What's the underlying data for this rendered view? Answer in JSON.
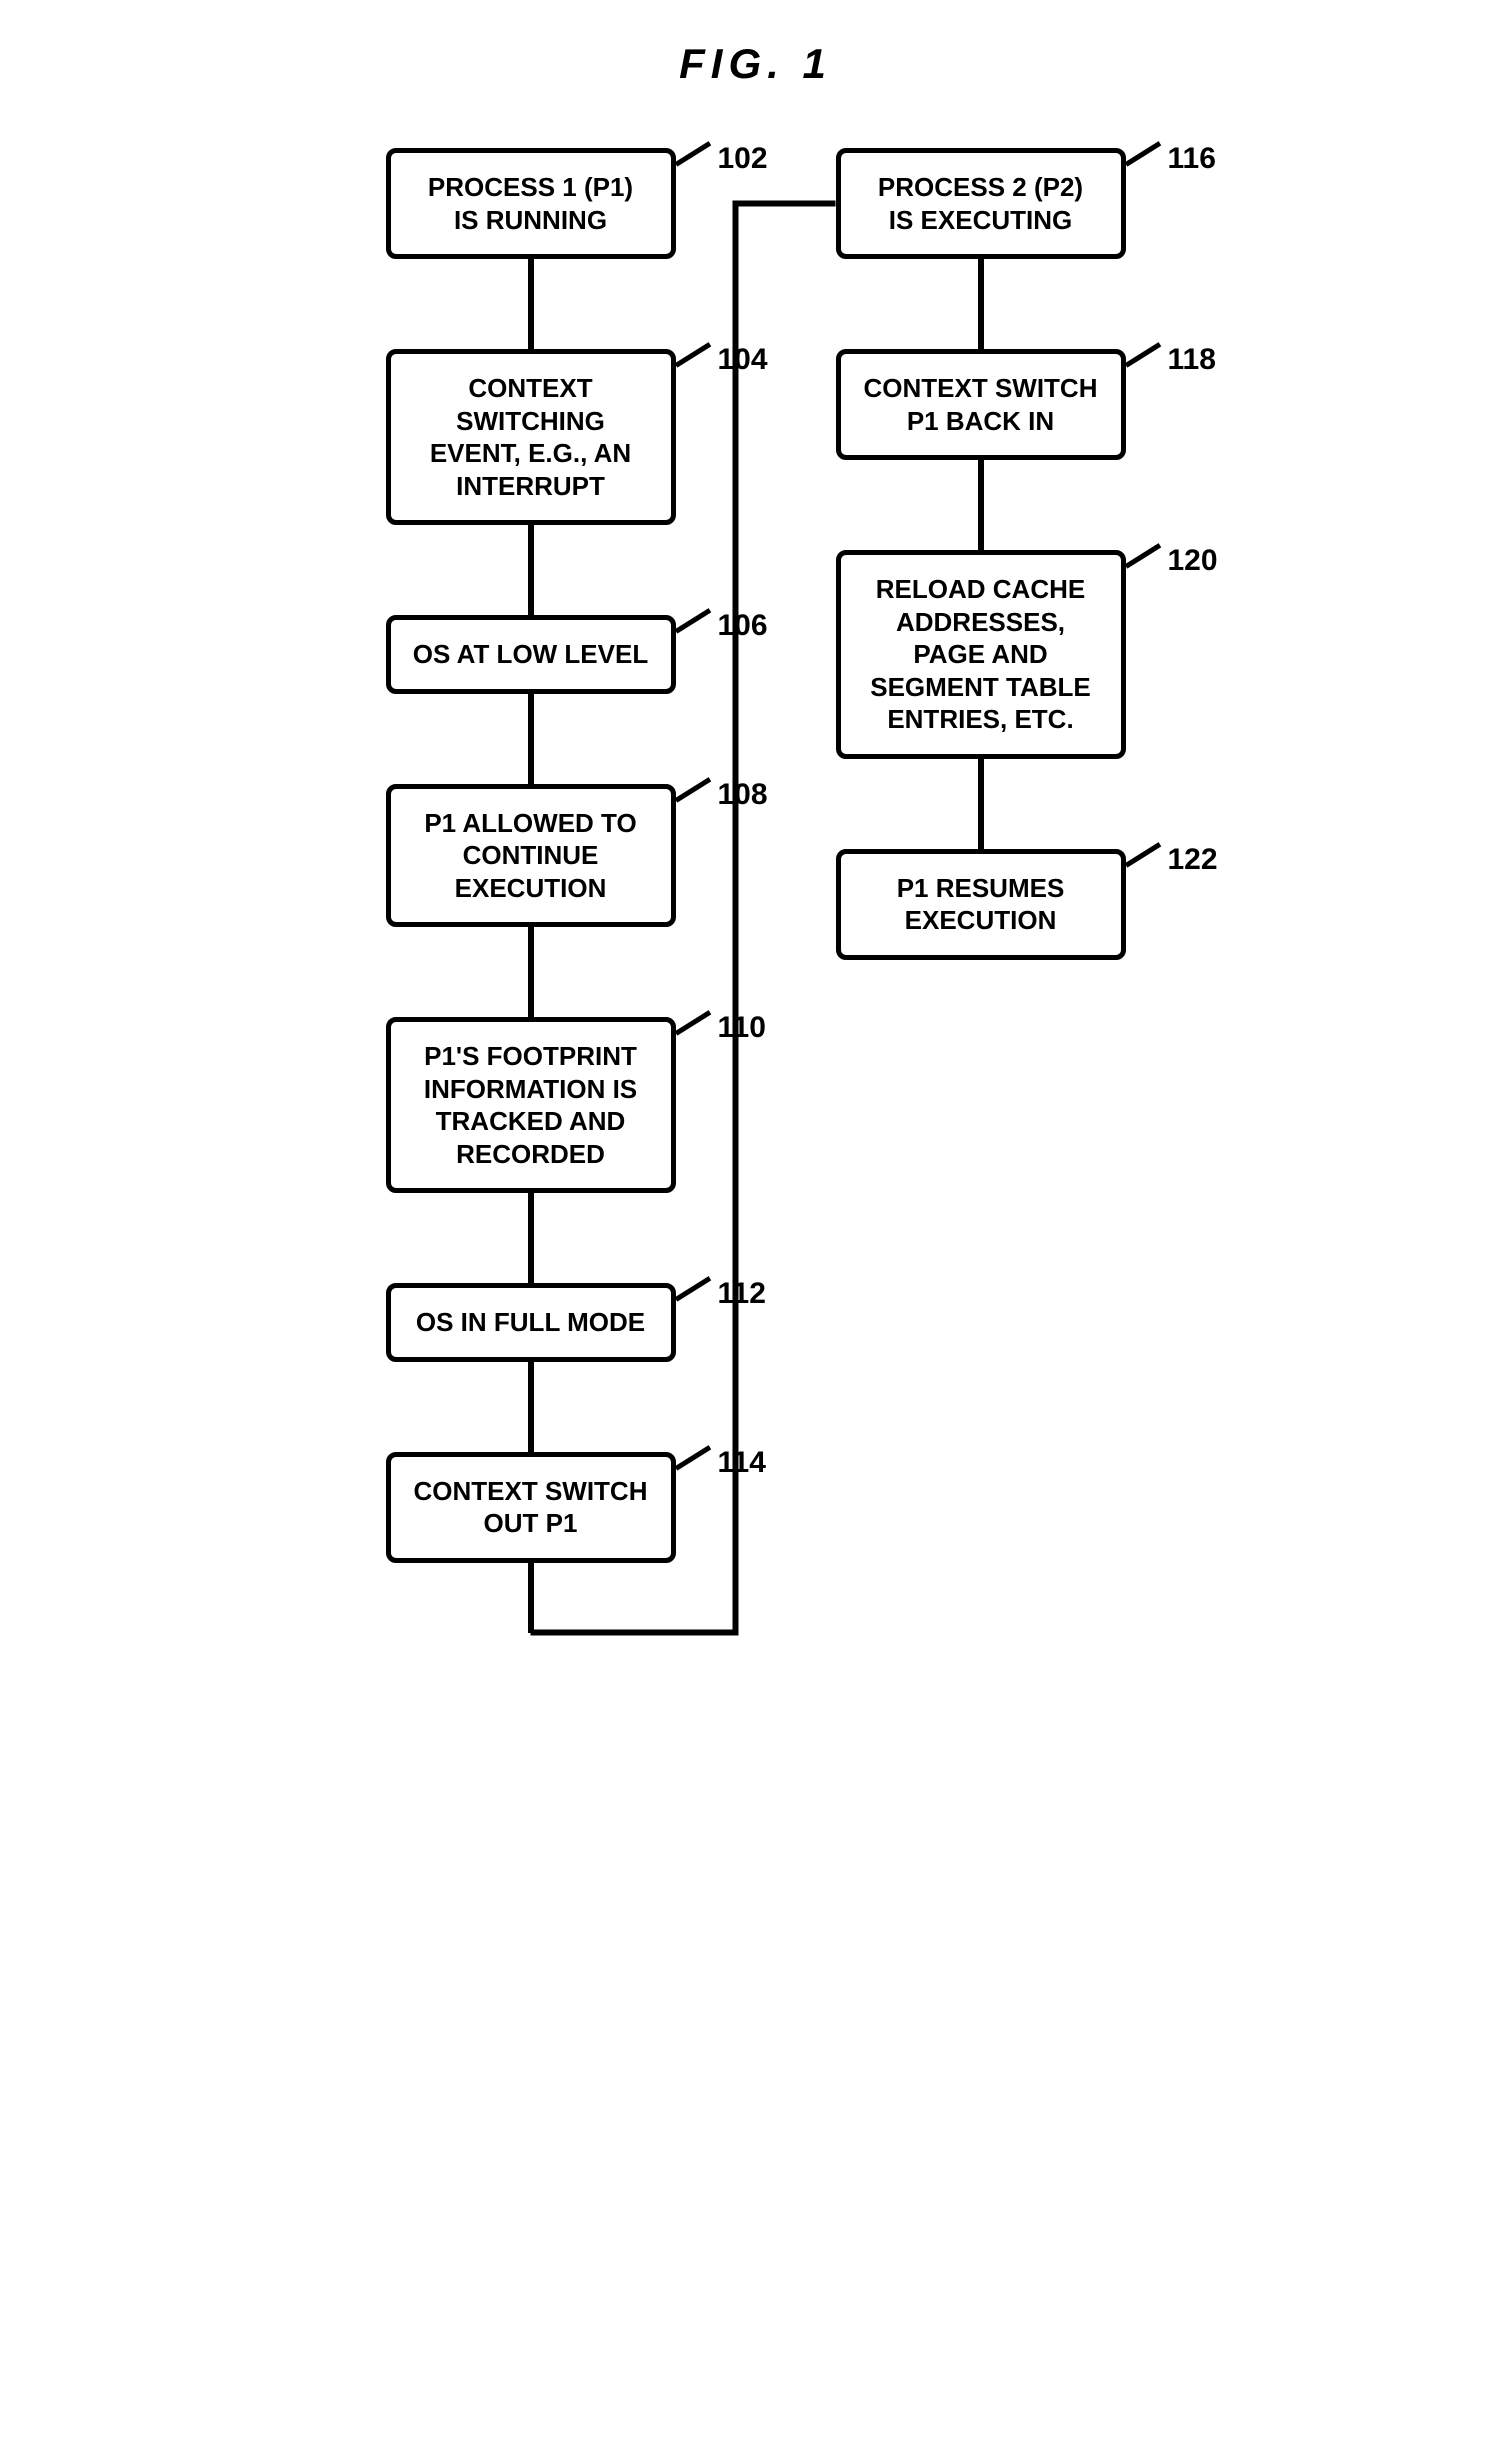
{
  "title": "FIG. 1",
  "col1": {
    "n102": {
      "text": "PROCESS 1 (P1) IS RUNNING",
      "num": "102"
    },
    "n104": {
      "text": "CONTEXT SWITCHING EVENT, E.G., AN INTERRUPT",
      "num": "104"
    },
    "n106": {
      "text": "OS AT LOW LEVEL",
      "num": "106"
    },
    "n108": {
      "text": "P1 ALLOWED TO CONTINUE EXECUTION",
      "num": "108"
    },
    "n110": {
      "text": "P1'S FOOTPRINT INFORMATION IS TRACKED AND RECORDED",
      "num": "110"
    },
    "n112": {
      "text": "OS IN FULL MODE",
      "num": "112"
    },
    "n114": {
      "text": "CONTEXT SWITCH OUT P1",
      "num": "114"
    }
  },
  "col2": {
    "n116": {
      "text": "PROCESS 2 (P2) IS EXECUTING",
      "num": "116"
    },
    "n118": {
      "text": "CONTEXT SWITCH P1 BACK IN",
      "num": "118"
    },
    "n120": {
      "text": "RELOAD CACHE ADDRESSES, PAGE AND SEGMENT TABLE ENTRIES, ETC.",
      "num": "120"
    },
    "n122": {
      "text": "P1 RESUMES EXECUTION",
      "num": "122"
    }
  }
}
